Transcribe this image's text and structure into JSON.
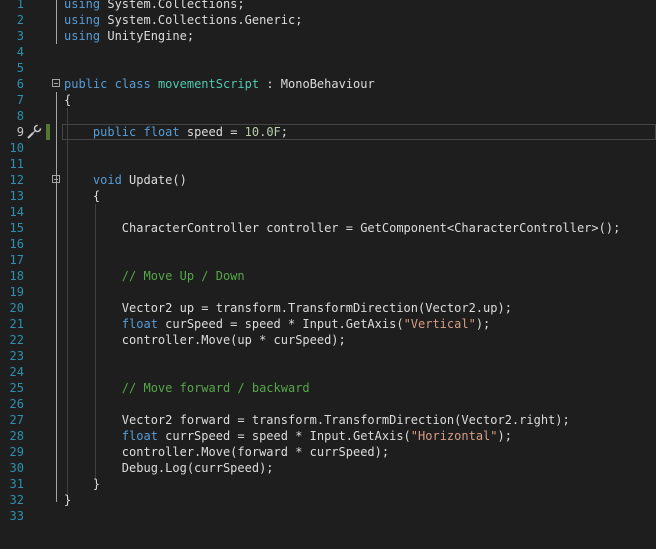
{
  "editor": {
    "current_line": 9,
    "lines": [
      {
        "n": "1",
        "tokens": [
          {
            "k": "kw",
            "t": "using"
          },
          {
            "k": "tx",
            "t": " System.Collections;"
          }
        ]
      },
      {
        "n": "2",
        "tokens": [
          {
            "k": "kw",
            "t": "using"
          },
          {
            "k": "tx",
            "t": " System.Collections.Generic;"
          }
        ]
      },
      {
        "n": "3",
        "tokens": [
          {
            "k": "kw",
            "t": "using"
          },
          {
            "k": "tx",
            "t": " UnityEngine;"
          }
        ]
      },
      {
        "n": "4",
        "tokens": []
      },
      {
        "n": "5",
        "tokens": []
      },
      {
        "n": "6",
        "tokens": [
          {
            "k": "kw",
            "t": "public"
          },
          {
            "k": "tx",
            "t": " "
          },
          {
            "k": "kw",
            "t": "class"
          },
          {
            "k": "tx",
            "t": " "
          },
          {
            "k": "ty",
            "t": "movementScript"
          },
          {
            "k": "tx",
            "t": " : "
          },
          {
            "k": "tx",
            "t": "MonoBehaviour"
          }
        ]
      },
      {
        "n": "7",
        "tokens": [
          {
            "k": "tx",
            "t": "{"
          }
        ]
      },
      {
        "n": "8",
        "tokens": []
      },
      {
        "n": "9",
        "tokens": [
          {
            "k": "tx",
            "t": "    "
          },
          {
            "k": "kw",
            "t": "public"
          },
          {
            "k": "tx",
            "t": " "
          },
          {
            "k": "kw",
            "t": "float"
          },
          {
            "k": "tx",
            "t": " speed = "
          },
          {
            "k": "num",
            "t": "10.0F"
          },
          {
            "k": "tx",
            "t": ";"
          }
        ]
      },
      {
        "n": "10",
        "tokens": []
      },
      {
        "n": "11",
        "tokens": []
      },
      {
        "n": "12",
        "tokens": [
          {
            "k": "tx",
            "t": "    "
          },
          {
            "k": "kw",
            "t": "void"
          },
          {
            "k": "tx",
            "t": " Update()"
          }
        ]
      },
      {
        "n": "13",
        "tokens": [
          {
            "k": "tx",
            "t": "    {"
          }
        ]
      },
      {
        "n": "14",
        "tokens": []
      },
      {
        "n": "15",
        "tokens": [
          {
            "k": "tx",
            "t": "        CharacterController controller = GetComponent<CharacterController>();"
          }
        ]
      },
      {
        "n": "16",
        "tokens": []
      },
      {
        "n": "17",
        "tokens": []
      },
      {
        "n": "18",
        "tokens": [
          {
            "k": "tx",
            "t": "        "
          },
          {
            "k": "cm",
            "t": "// Move Up / Down"
          }
        ]
      },
      {
        "n": "19",
        "tokens": []
      },
      {
        "n": "20",
        "tokens": [
          {
            "k": "tx",
            "t": "        Vector2 up = transform.TransformDirection(Vector2.up);"
          }
        ]
      },
      {
        "n": "21",
        "tokens": [
          {
            "k": "tx",
            "t": "        "
          },
          {
            "k": "kw",
            "t": "float"
          },
          {
            "k": "tx",
            "t": " curSpeed = speed * Input.GetAxis("
          },
          {
            "k": "str",
            "t": "\"Vertical\""
          },
          {
            "k": "tx",
            "t": ");"
          }
        ]
      },
      {
        "n": "22",
        "tokens": [
          {
            "k": "tx",
            "t": "        controller.Move(up * curSpeed);"
          }
        ]
      },
      {
        "n": "23",
        "tokens": []
      },
      {
        "n": "24",
        "tokens": []
      },
      {
        "n": "25",
        "tokens": [
          {
            "k": "tx",
            "t": "        "
          },
          {
            "k": "cm",
            "t": "// Move forward / backward"
          }
        ]
      },
      {
        "n": "26",
        "tokens": []
      },
      {
        "n": "27",
        "tokens": [
          {
            "k": "tx",
            "t": "        Vector2 forward = transform.TransformDirection(Vector2.right);"
          }
        ]
      },
      {
        "n": "28",
        "tokens": [
          {
            "k": "tx",
            "t": "        "
          },
          {
            "k": "kw",
            "t": "float"
          },
          {
            "k": "tx",
            "t": " currSpeed = speed * Input.GetAxis("
          },
          {
            "k": "str",
            "t": "\"Horizontal\""
          },
          {
            "k": "tx",
            "t": ");"
          }
        ]
      },
      {
        "n": "29",
        "tokens": [
          {
            "k": "tx",
            "t": "        controller.Move(forward * currSpeed);"
          }
        ]
      },
      {
        "n": "30",
        "tokens": [
          {
            "k": "tx",
            "t": "        Debug.Log(currSpeed);"
          }
        ]
      },
      {
        "n": "31",
        "tokens": [
          {
            "k": "tx",
            "t": "    }"
          }
        ]
      },
      {
        "n": "32",
        "tokens": [
          {
            "k": "tx",
            "t": "}"
          }
        ]
      },
      {
        "n": "33",
        "tokens": []
      }
    ]
  },
  "icons": {
    "quick_actions": "screwdriver-icon",
    "fold": "fold-toggle-icon"
  },
  "colors": {
    "background": "#1e1e1e",
    "line_number": "#2b91af",
    "keyword": "#569cd6",
    "type": "#4ec9b0",
    "string": "#d69d85",
    "number": "#b5cea8",
    "comment": "#57a64a",
    "text": "#dcdcdc"
  }
}
